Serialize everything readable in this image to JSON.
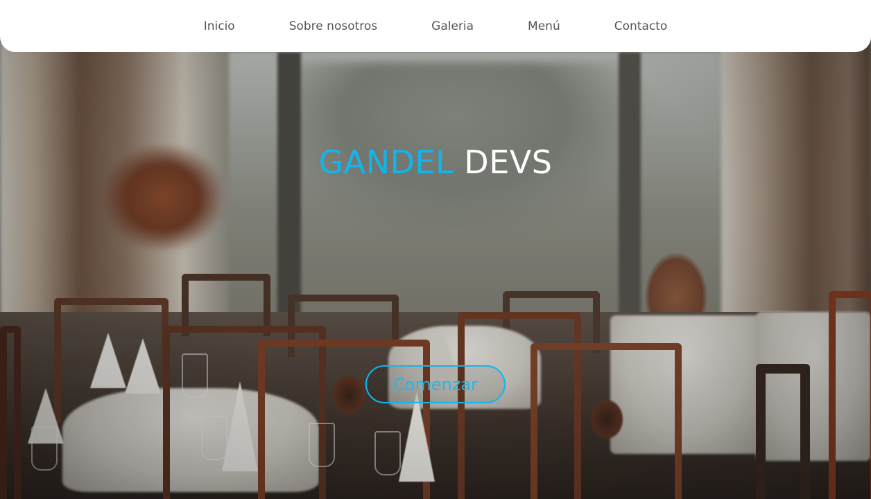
{
  "nav": {
    "items": [
      {
        "label": "Inicio"
      },
      {
        "label": "Sobre nosotros"
      },
      {
        "label": "Galeria"
      },
      {
        "label": "Menú"
      },
      {
        "label": "Contacto"
      }
    ]
  },
  "hero": {
    "title_accent": "GANDEL",
    "title_rest": "DEVS",
    "cta_label": "Comenzar",
    "background_image": "restaurant-dining-room-photo"
  },
  "colors": {
    "accent": "#11b5ee",
    "nav_bg": "#ffffff",
    "nav_text": "#555555",
    "title_rest": "#ffffff"
  }
}
